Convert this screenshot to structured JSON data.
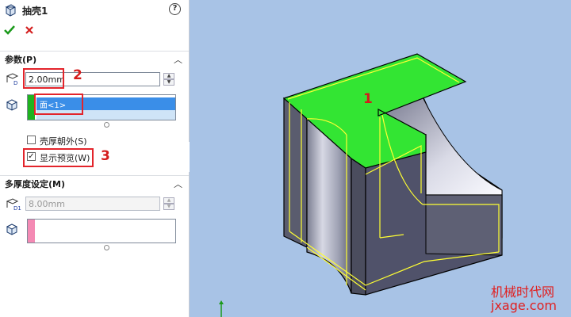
{
  "feature": {
    "title": "抽壳1",
    "help_icon": "question-icon",
    "ok_icon": "check-icon",
    "cancel_icon": "x-icon"
  },
  "params": {
    "section_title": "参数(P)",
    "thickness_value": "2.00mm",
    "face_item": "面<1>",
    "shell_outward_label": "壳厚朝外(S)",
    "shell_outward_checked": false,
    "show_preview_label": "显示预览(W)",
    "show_preview_checked": true
  },
  "multi_thickness": {
    "section_title": "多厚度设定(M)",
    "thickness_value": "8.00mm"
  },
  "annotations": {
    "n1": "1",
    "n2": "2",
    "n3": "3"
  },
  "watermark": {
    "line1": "机械时代网",
    "line2": "jxage.com"
  },
  "colors": {
    "selected_face": "#33e533",
    "edge_highlight": "#ffff33",
    "part_gray": "#5e6072",
    "viewport_bg": "#a8c3e6",
    "annotation_red": "#e3242b"
  }
}
